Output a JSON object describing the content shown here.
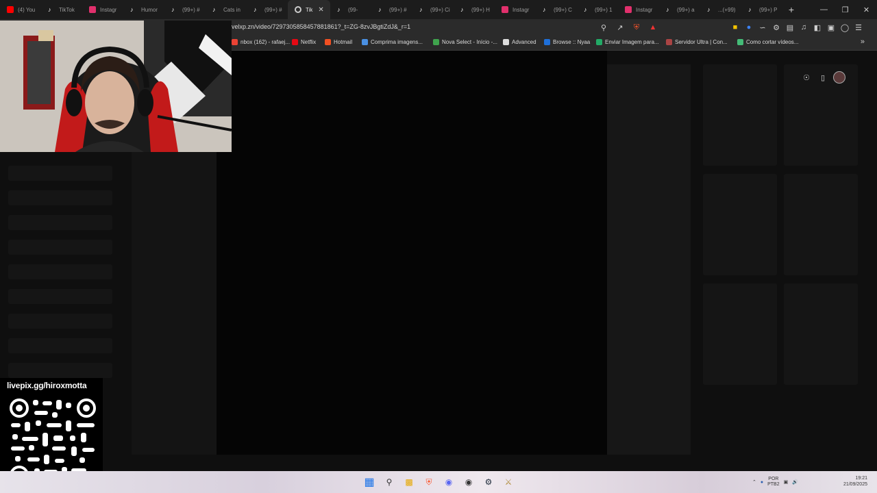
{
  "tabs": [
    {
      "label": "(4) You",
      "icon": "youtube-icon",
      "color": "#ff0000"
    },
    {
      "label": "TikTok",
      "icon": "tiktok-icon",
      "color": "#ffffff"
    },
    {
      "label": "Instagr",
      "icon": "instagram-icon",
      "color": "#e1306c"
    },
    {
      "label": "Humor",
      "icon": "tiktok-icon",
      "color": "#ffffff"
    },
    {
      "label": "(99+) #",
      "icon": "tiktok-icon",
      "color": "#ffffff"
    },
    {
      "label": "Cats in",
      "icon": "tiktok-icon",
      "color": "#ffffff"
    },
    {
      "label": "(99+) #",
      "icon": "tiktok-icon",
      "color": "#ffffff"
    },
    {
      "label": "Tik",
      "icon": "loading-icon",
      "color": "#cccccc",
      "active": true
    },
    {
      "label": "(99-",
      "icon": "tiktok-icon",
      "color": "#ffffff"
    },
    {
      "label": "(99+) #",
      "icon": "tiktok-icon",
      "color": "#ffffff"
    },
    {
      "label": "(99+) Ci",
      "icon": "tiktok-icon",
      "color": "#ffffff"
    },
    {
      "label": "(99+) H",
      "icon": "tiktok-icon",
      "color": "#ffffff"
    },
    {
      "label": "Instagr",
      "icon": "instagram-icon",
      "color": "#e1306c"
    },
    {
      "label": "(99+) C",
      "icon": "tiktok-icon",
      "color": "#ffffff"
    },
    {
      "label": "(99+) 1",
      "icon": "tiktok-icon",
      "color": "#ffffff"
    },
    {
      "label": "Instagr",
      "icon": "instagram-icon",
      "color": "#e1306c"
    },
    {
      "label": "(99+) a",
      "icon": "tiktok-icon",
      "color": "#ffffff"
    },
    {
      "label": "...(+99)",
      "icon": "tiktok-icon",
      "color": "#ffffff"
    },
    {
      "label": "(99+) P",
      "icon": "tiktok-icon",
      "color": "#ffffff"
    }
  ],
  "address_bar": {
    "url": "velxp.zn/video/7297305858457881861?_t=ZG-8zvJBgtiZdJ&_r=1"
  },
  "bookmarks": [
    {
      "label": "nbox (162) - rafaej...",
      "color": "#ea4335"
    },
    {
      "label": "Netflix",
      "color": "#e50914"
    },
    {
      "label": "Hotmail",
      "color": "#f25022"
    },
    {
      "label": "Comprima imagens...",
      "color": "#4a90e2"
    },
    {
      "label": "Nova Select - Início -...",
      "color": "#3fa34d"
    },
    {
      "label": "Advanced",
      "color": "#dddddd"
    },
    {
      "label": "Browse :: Nyaa",
      "color": "#1e6fd9"
    },
    {
      "label": "Enviar Imagem para...",
      "color": "#22aa66"
    },
    {
      "label": "Servidor Ultra | Con...",
      "color": "#aa4444"
    },
    {
      "label": "Como cortar vídeos...",
      "color": "#44bb77"
    }
  ],
  "overlay": {
    "livepix_url": "livepix.gg/hiroxmotta"
  },
  "tray": {
    "language_top": "POR",
    "language_bottom": "PTB2",
    "time": "19:21",
    "date": "21/09/2025"
  },
  "colors": {
    "page_bg": "#0f0f0f",
    "tab_bg": "#1c1c1c",
    "toolbar_bg": "#2b2b2b"
  }
}
